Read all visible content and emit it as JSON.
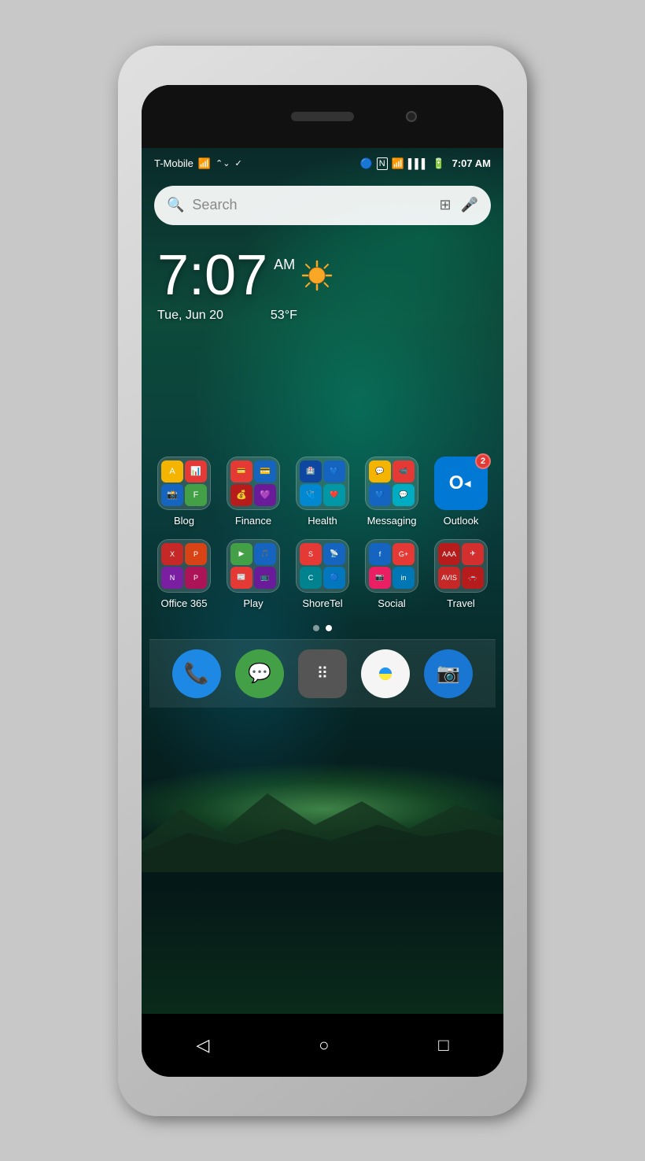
{
  "phone": {
    "status_bar": {
      "carrier": "T-Mobile",
      "time": "7:07 AM",
      "bluetooth_icon": "🔵",
      "wifi_icon": "📶",
      "battery_icon": "🔋"
    },
    "search": {
      "placeholder": "Search"
    },
    "clock": {
      "time": "7:07",
      "am_pm": "AM",
      "date": "Tue, Jun 20",
      "temp": "53°F"
    },
    "folders": [
      {
        "id": "blog",
        "label": "Blog"
      },
      {
        "id": "finance",
        "label": "Finance"
      },
      {
        "id": "health",
        "label": "Health"
      },
      {
        "id": "messaging",
        "label": "Messaging"
      },
      {
        "id": "outlook",
        "label": "Outlook",
        "badge": "2"
      },
      {
        "id": "office365",
        "label": "Office 365"
      },
      {
        "id": "play",
        "label": "Play"
      },
      {
        "id": "shoretel",
        "label": "ShoreTel"
      },
      {
        "id": "social",
        "label": "Social"
      },
      {
        "id": "travel",
        "label": "Travel"
      }
    ],
    "page_dots": [
      {
        "active": false
      },
      {
        "active": true
      }
    ],
    "dock": [
      {
        "id": "phone",
        "label": "Phone",
        "color": "#1e88e5"
      },
      {
        "id": "hangouts",
        "label": "Hangouts",
        "color": "#43a047"
      },
      {
        "id": "apps",
        "label": "Apps",
        "color": "#424242"
      },
      {
        "id": "photos",
        "label": "Photos",
        "color": "#f5f5f5"
      },
      {
        "id": "camera",
        "label": "Camera",
        "color": "#1976d2"
      }
    ],
    "nav": {
      "back": "◁",
      "home": "○",
      "recent": "□"
    }
  }
}
